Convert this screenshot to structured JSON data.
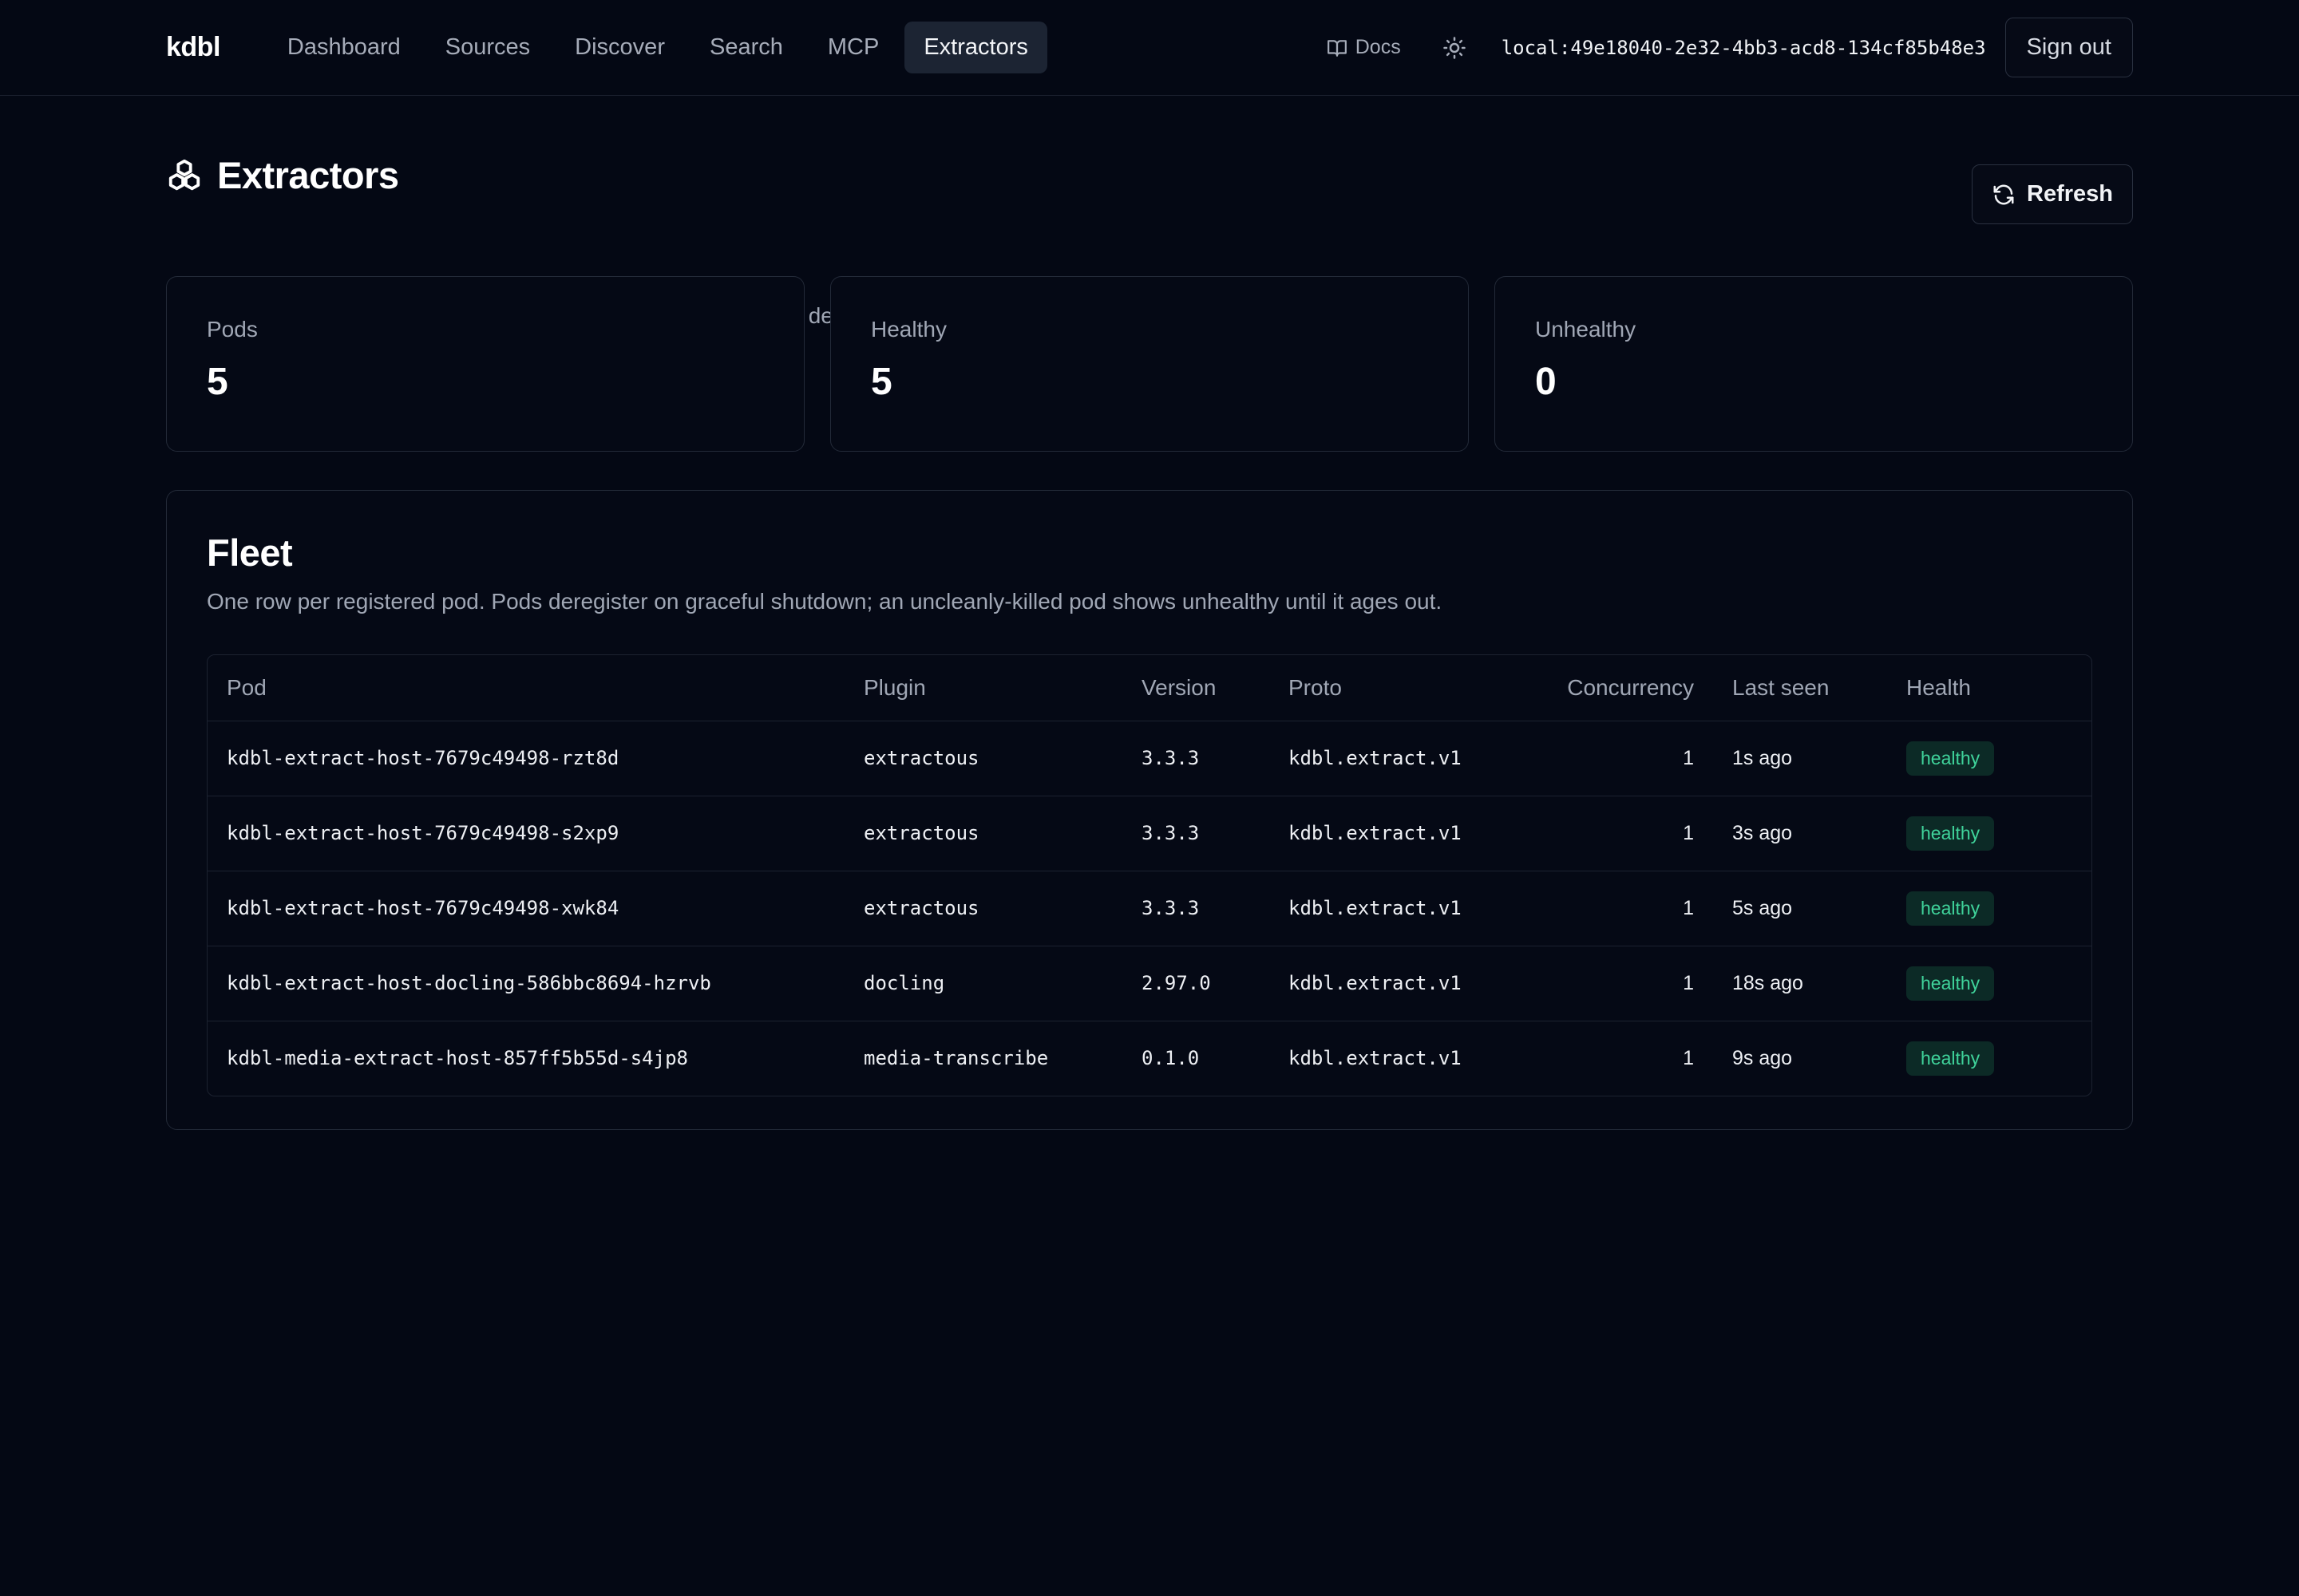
{
  "nav": {
    "brand": "kdbl",
    "links": [
      {
        "label": "Dashboard",
        "active": false
      },
      {
        "label": "Sources",
        "active": false
      },
      {
        "label": "Discover",
        "active": false
      },
      {
        "label": "Search",
        "active": false
      },
      {
        "label": "MCP",
        "active": false
      },
      {
        "label": "Extractors",
        "active": true
      }
    ],
    "docs_label": "Docs",
    "docs_icon": "book-open-icon",
    "theme_icon": "sun-icon",
    "session_id": "local:49e18040-2e32-4bb3-acd8-134cf85b48e3",
    "signout_label": "Sign out"
  },
  "page": {
    "title": "Extractors",
    "title_icon": "boxes-icon",
    "subtitle": "Content-extraction host pods and the plugin each runs. Health is derived from heartbeat freshness (healthy < 90s since last seen).",
    "refresh_label": "Refresh",
    "refresh_icon": "refresh-icon"
  },
  "stats": [
    {
      "label": "Pods",
      "value": "5"
    },
    {
      "label": "Healthy",
      "value": "5"
    },
    {
      "label": "Unhealthy",
      "value": "0"
    }
  ],
  "fleet": {
    "title": "Fleet",
    "subtitle": "One row per registered pod. Pods deregister on graceful shutdown; an uncleanly-killed pod shows unhealthy until it ages out.",
    "columns": [
      "Pod",
      "Plugin",
      "Version",
      "Proto",
      "Concurrency",
      "Last seen",
      "Health"
    ],
    "rows": [
      {
        "pod": "kdbl-extract-host-7679c49498-rzt8d",
        "plugin": "extractous",
        "version": "3.3.3",
        "proto": "kdbl.extract.v1",
        "concurrency": "1",
        "last_seen": "1s ago",
        "health": "healthy"
      },
      {
        "pod": "kdbl-extract-host-7679c49498-s2xp9",
        "plugin": "extractous",
        "version": "3.3.3",
        "proto": "kdbl.extract.v1",
        "concurrency": "1",
        "last_seen": "3s ago",
        "health": "healthy"
      },
      {
        "pod": "kdbl-extract-host-7679c49498-xwk84",
        "plugin": "extractous",
        "version": "3.3.3",
        "proto": "kdbl.extract.v1",
        "concurrency": "1",
        "last_seen": "5s ago",
        "health": "healthy"
      },
      {
        "pod": "kdbl-extract-host-docling-586bbc8694-hzrvb",
        "plugin": "docling",
        "version": "2.97.0",
        "proto": "kdbl.extract.v1",
        "concurrency": "1",
        "last_seen": "18s ago",
        "health": "healthy"
      },
      {
        "pod": "kdbl-media-extract-host-857ff5b55d-s4jp8",
        "plugin": "media-transcribe",
        "version": "0.1.0",
        "proto": "kdbl.extract.v1",
        "concurrency": "1",
        "last_seen": "9s ago",
        "health": "healthy"
      }
    ]
  },
  "colors": {
    "background": "#040814",
    "healthy_text": "#3fd29a",
    "healthy_bg": "#0c2a26",
    "active_nav_bg": "#1c2433"
  }
}
